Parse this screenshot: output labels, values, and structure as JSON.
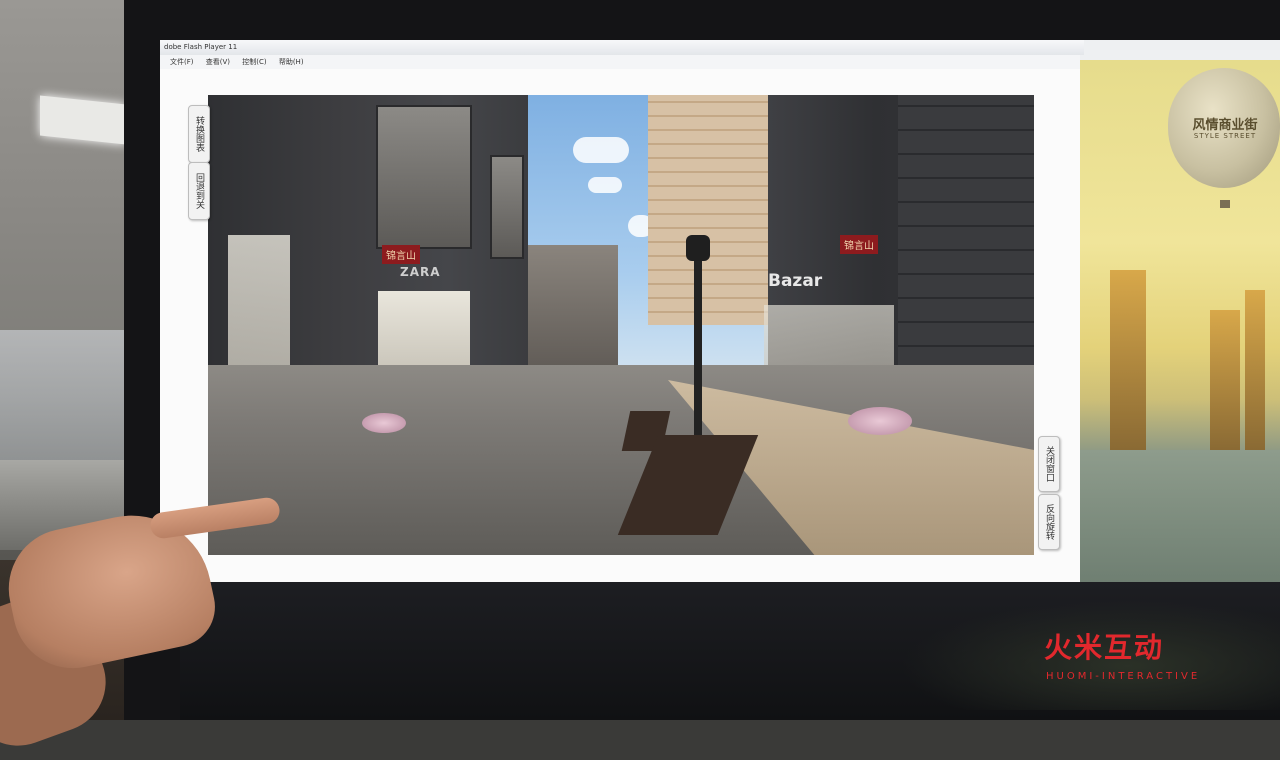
{
  "window": {
    "title": "dobe Flash Player 11",
    "menu": [
      "文件(F)",
      "查看(V)",
      "控制(C)",
      "帮助(H)"
    ]
  },
  "side_buttons": {
    "left_top": "转换图表",
    "left_second": "回退到关",
    "right_close": "关闭窗口",
    "right_reverse": "反向旋转"
  },
  "scene": {
    "sign_bazar": "Bazar",
    "sign_zara": "ZARA",
    "sign_red_1": "锦言山",
    "sign_red_2": "锦言山"
  },
  "banner": {
    "title": "风情商业街",
    "subtitle": "STYLE STREET"
  },
  "watermark": {
    "logo": "火米互动",
    "sub": "HUOMI-INTERACTIVE",
    "color": "#e2282d"
  }
}
